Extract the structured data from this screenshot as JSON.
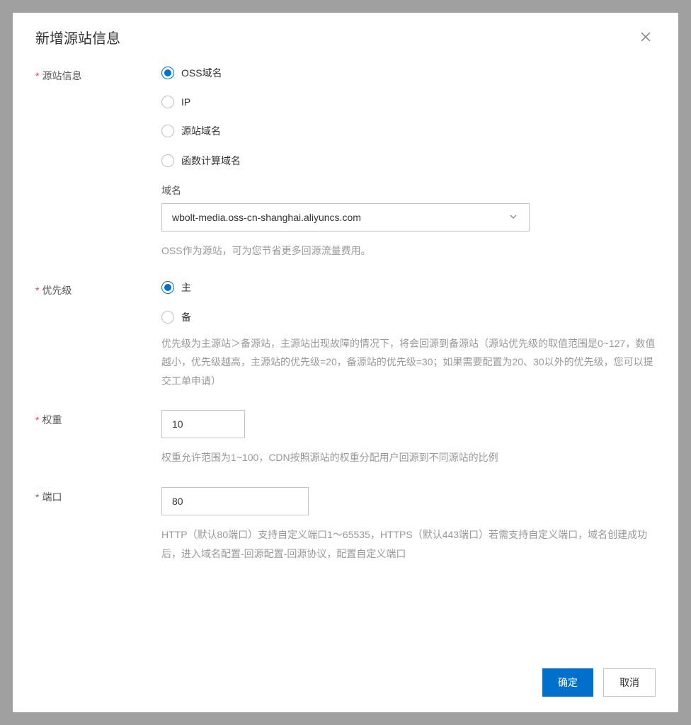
{
  "modal": {
    "title": "新增源站信息"
  },
  "form": {
    "origin": {
      "label": "源站信息",
      "options": {
        "oss": "OSS域名",
        "ip": "IP",
        "domain": "源站域名",
        "fc": "函数计算域名"
      },
      "selected": "oss",
      "domain_label": "域名",
      "domain_value": "wbolt-media.oss-cn-shanghai.aliyuncs.com",
      "help": "OSS作为源站，可为您节省更多回源流量费用。"
    },
    "priority": {
      "label": "优先级",
      "options": {
        "primary": "主",
        "backup": "备"
      },
      "selected": "primary",
      "help": "优先级为主源站＞备源站，主源站出现故障的情况下，将会回源到备源站（源站优先级的取值范围是0~127，数值越小，优先级越高，主源站的优先级=20，备源站的优先级=30；如果需要配置为20、30以外的优先级，您可以提交工单申请）"
    },
    "weight": {
      "label": "权重",
      "value": "10",
      "help": "权重允许范围为1~100，CDN按照源站的权重分配用户回源到不同源站的比例"
    },
    "port": {
      "label": "端口",
      "value": "80",
      "help": "HTTP（默认80端口）支持自定义端口1～65535，HTTPS（默认443端口）若需支持自定义端口，域名创建成功后，进入域名配置-回源配置-回源协议，配置自定义端口"
    }
  },
  "footer": {
    "confirm": "确定",
    "cancel": "取消"
  }
}
